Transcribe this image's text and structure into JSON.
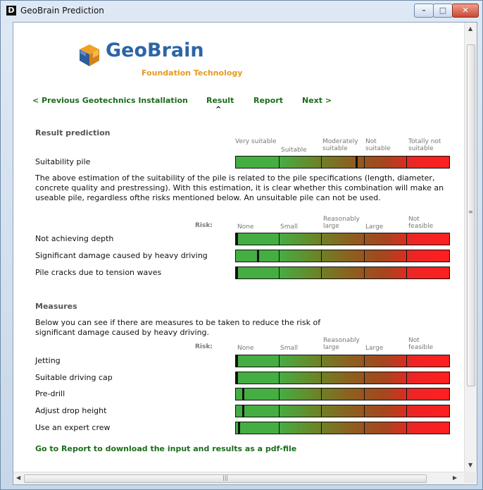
{
  "window": {
    "title": "GeoBrain Prediction",
    "app_icon": "D"
  },
  "window_buttons": {
    "minimize": "–",
    "maximize": "□",
    "close": "✕"
  },
  "logo": {
    "name": "GeoBrain",
    "tagline": "Foundation Technology",
    "icon": "cube-logo-icon"
  },
  "nav": {
    "previous": "< Previous Geotechnics Installation",
    "result": "Result",
    "report": "Report",
    "next": "Next >",
    "caret": "^"
  },
  "result_prediction": {
    "title": "Result prediction",
    "scale_labels": [
      "Very suitable",
      "Suitable",
      "Moderately suitable",
      "Not suitable",
      "Totally not suitable"
    ],
    "rows": [
      {
        "label": "Suitability pile",
        "value": 0.56
      }
    ],
    "description": "The above estimation of the suitability of the pile is related to the pile specifications (length, diameter, concrete quality and prestressing). With this estimation, it is clear whether this combination will make an useable pile, regardless ofthe risks mentioned below. An unsuitable pile can not be used."
  },
  "risk_section": {
    "risk_label": "Risk:",
    "scale_labels": [
      "None",
      "Small",
      "Reasonably large",
      "Large",
      "Not feasible"
    ],
    "rows": [
      {
        "label": "Not achieving depth",
        "value": 0.0
      },
      {
        "label": "Significant damage caused by heavy driving",
        "value": 0.1
      },
      {
        "label": "Pile cracks due to tension waves",
        "value": 0.0
      }
    ]
  },
  "measures": {
    "title": "Measures",
    "description": "Below you can see if there are measures to be taken to reduce the risk of significant damage caused by heavy driving.",
    "risk_label": "Risk:",
    "scale_labels": [
      "None",
      "Small",
      "Reasonably large",
      "Large",
      "Not feasible"
    ],
    "rows": [
      {
        "label": "Jetting",
        "value": 0.0
      },
      {
        "label": "Suitable driving cap",
        "value": 0.0
      },
      {
        "label": "Pre-drill",
        "value": 0.03
      },
      {
        "label": "Adjust drop height",
        "value": 0.03
      },
      {
        "label": "Use an expert crew",
        "value": 0.01
      }
    ]
  },
  "footer_link": "Go to Report to download the input and results as a pdf-file",
  "scrollbars": {
    "up": "▲",
    "down": "▼",
    "left": "◀",
    "right": "▶",
    "grip": "≡",
    "hgrip": "|||"
  }
}
